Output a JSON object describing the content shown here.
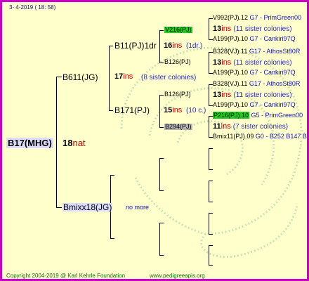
{
  "header": {
    "date": "3-  4-2019  ( 18:  58)"
  },
  "root": {
    "name": "B17(MHG)",
    "num": "18",
    "origin": "nat"
  },
  "gen1": {
    "mother": {
      "name": "B611(JG)",
      "count": "17",
      "ins": "ins",
      "sisters": "(8 sister colonies)"
    },
    "father": {
      "name": "Bmixx18(JG)",
      "note": "no more"
    }
  },
  "gen2": {
    "a": {
      "name": "B11(PJ)1dr",
      "count": "16",
      "ins": "ins",
      "sisters": "(1dr.)"
    },
    "b": {
      "name": "B171(PJ)",
      "count": "15",
      "ins": "ins",
      "sisters": "(10 c.)"
    }
  },
  "gen3": [
    "V216(PJ)",
    "B126(PJ)",
    "B126(PJ)",
    "B294(PJ)"
  ],
  "gen4": {
    "b1": {
      "top": "V992(PJ).12",
      "top_right": "G7 - PrimGreen00",
      "count": "13",
      "ins": "ins",
      "sisters": "(11 sister colonies)",
      "bot": "A199(PJ).10",
      "bot_right": "G7 - Cankiri97Q"
    },
    "b2": {
      "top": "B328(VJ).11",
      "top_right": "G17 - AthosSt80R",
      "count": "13",
      "ins": "ins",
      "sisters": "(11 sister colonies)",
      "bot": "A199(PJ).10",
      "bot_right": "G7 - Cankiri97Q"
    },
    "b3": {
      "top": "B328(VJ).11",
      "top_right": "G17 - AthosSt80R",
      "count": "13",
      "ins": "ins",
      "sisters": "(11 sister colonies)",
      "bot": "A199(PJ).10",
      "bot_right": "G7 - Cankiri97Q"
    },
    "b4": {
      "top": "P216(PJ).10",
      "top_right": "G5 - PrimGreen00",
      "count": "11",
      "ins": "ins",
      "sisters": "(7 sister colonies)",
      "bot": "Bmix11(PJ).09",
      "bot_right": "G0 - B252 B147 B"
    }
  },
  "footer": {
    "copyright": "Copyright 2004-2019 @ Karl Kehrle Foundation",
    "website": "www.pedigreeapis.org"
  },
  "colors": {
    "border": "#c800c8",
    "background": "#ffffcc",
    "highlight_green": "#1ad21a",
    "ins_red": "#cc0000",
    "footer_green": "#0b6f0b"
  }
}
